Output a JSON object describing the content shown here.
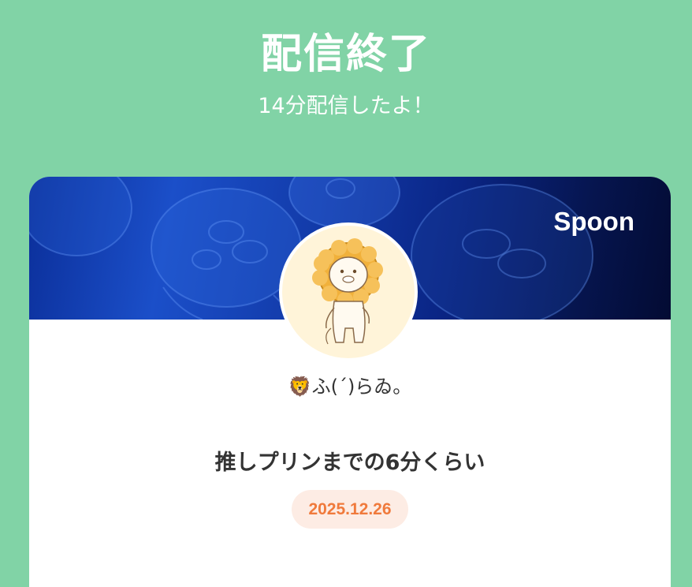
{
  "header": {
    "title": "配信終了",
    "subtitle": "14分配信したよ！"
  },
  "card": {
    "brand": "Spoon",
    "user": {
      "emoji": "🦁",
      "name": "ふ(ˊ)らゐ。"
    },
    "stream_title": "推しプリンまでの6分くらい",
    "date": "2025.12.26"
  },
  "colors": {
    "background": "#81d3a6",
    "date_text": "#f07a3c",
    "date_badge_bg": "#fdece4"
  }
}
